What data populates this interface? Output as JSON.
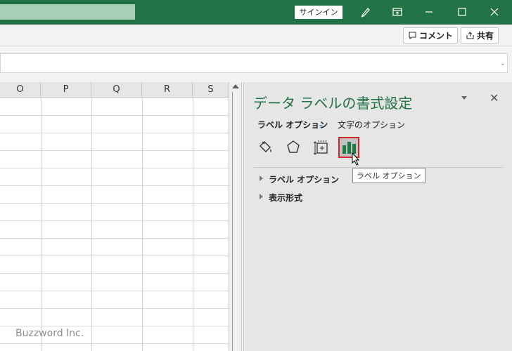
{
  "titlebar": {
    "signin_label": "サインイン"
  },
  "ribbon": {
    "comment_label": "コメント",
    "share_label": "共有"
  },
  "grid": {
    "columns": [
      "O",
      "P",
      "Q",
      "R",
      "S"
    ]
  },
  "pane": {
    "title": "データ ラベルの書式設定",
    "tab_label_options": "ラベル オプション",
    "tab_text_options": "文字のオプション",
    "icons": [
      "fill-line-icon",
      "effects-icon",
      "size-properties-icon",
      "label-options-icon"
    ],
    "sections": [
      "ラベル オプション",
      "表示形式"
    ],
    "tooltip": "ラベル オプション"
  },
  "watermark": "Buzzword Inc.",
  "colors": {
    "excel_green": "#217346",
    "selection_red": "#d3262c",
    "bar_green": "#1e7b45"
  }
}
